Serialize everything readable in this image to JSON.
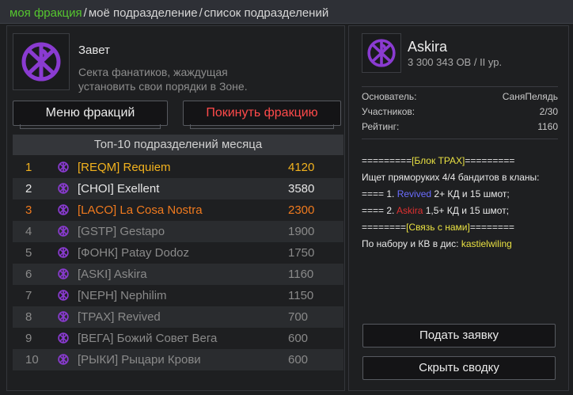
{
  "breadcrumb": {
    "items": [
      "моя фракция",
      "моё подразделение",
      "список подразделений"
    ],
    "separator": "/"
  },
  "faction": {
    "name": "Завет",
    "description": "Секта фанатиков, жаждущая установить свои порядки в Зоне.",
    "menu_button": "Меню фракций",
    "leave_button": "Покинуть фракцию"
  },
  "top": {
    "header": "Топ-10 подразделений месяца",
    "rows": [
      {
        "rank": "1",
        "name": "[REQM] Requiem",
        "value": "4120",
        "color": "#f2b21e"
      },
      {
        "rank": "2",
        "name": "[CHOI] Exellent",
        "value": "3580",
        "color": "#e6e6e6"
      },
      {
        "rank": "3",
        "name": "[LACO] La Cosa Nostra",
        "value": "2300",
        "color": "#f07a1e"
      },
      {
        "rank": "4",
        "name": "[GSTP] Gestapo",
        "value": "1900",
        "color": "#8a8a8a"
      },
      {
        "rank": "5",
        "name": "[ФОНК] Patay Dodoz",
        "value": "1750",
        "color": "#8a8a8a"
      },
      {
        "rank": "6",
        "name": "[ASKI] Askira",
        "value": "1160",
        "color": "#8a8a8a"
      },
      {
        "rank": "7",
        "name": "[NEPH] Nephilim",
        "value": "1150",
        "color": "#8a8a8a"
      },
      {
        "rank": "8",
        "name": "[TPAX] Revived",
        "value": "700",
        "color": "#8a8a8a"
      },
      {
        "rank": "9",
        "name": "[ВЕГА] Божий Совет Вега",
        "value": "600",
        "color": "#8a8a8a"
      },
      {
        "rank": "10",
        "name": "[РЫКИ] Рыцари Крови",
        "value": "600",
        "color": "#8a8a8a"
      }
    ]
  },
  "division": {
    "name": "Askira",
    "sub": "3 300 343 OB / II ур.",
    "founder_label": "Основатель:",
    "founder_value": "СаняПелядь",
    "members_label": "Участников:",
    "members_value": "2/30",
    "rating_label": "Рейтинг:",
    "rating_value": "1160",
    "info": {
      "l1_pre": "=========",
      "l1_tag": "[Блок TPAX]",
      "l1_post": "=========",
      "l2": "Ищет пряморуких 4/4 бандитов в кланы:",
      "l3_pre": "==== 1. ",
      "l3_name": "Revived",
      "l3_post": " 2+ КД и 15 шмот;",
      "l4_pre": "==== 2. ",
      "l4_name": "Askira",
      "l4_post": " 1,5+ КД и 15 шмот;",
      "l5_pre": "========",
      "l5_tag": "[Связь с нами]",
      "l5_post": "========",
      "l6_pre": "По набору и КВ в дис: ",
      "l6_nick": "kastielwiling"
    },
    "apply_button": "Подать заявку",
    "hide_button": "Скрыть сводку"
  },
  "colors": {
    "active_crumb": "#55c62f",
    "emblem": "#8a3bd1",
    "leave": "#ff4a4a"
  },
  "icons": [
    "faction-emblem-icon",
    "division-emblem-icon"
  ]
}
